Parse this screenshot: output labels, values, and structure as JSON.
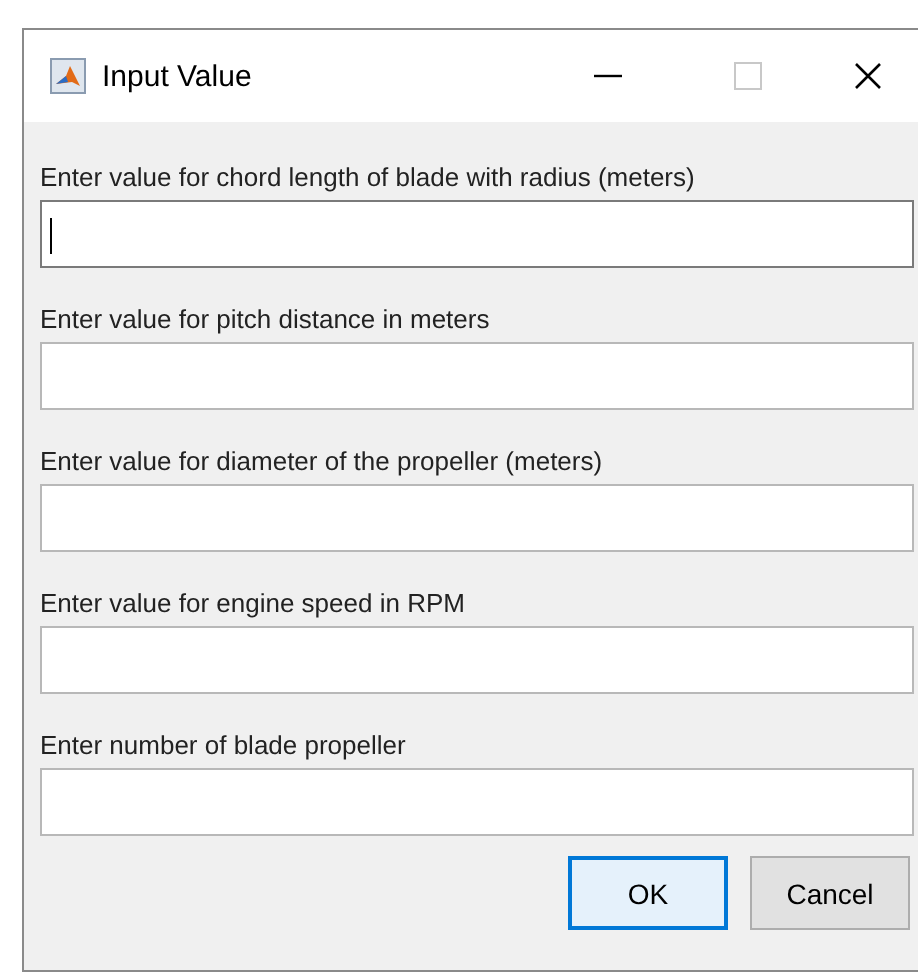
{
  "window": {
    "title": "Input Value"
  },
  "fields": [
    {
      "label": "Enter value for chord length of blade with radius (meters)",
      "focused": true
    },
    {
      "label": "Enter value for pitch distance in meters",
      "focused": false
    },
    {
      "label": "Enter value for diameter of the propeller (meters)",
      "focused": false
    },
    {
      "label": "Enter value for engine speed in RPM",
      "focused": false
    },
    {
      "label": "Enter number of blade propeller",
      "focused": false
    }
  ],
  "buttons": [
    {
      "label": "OK",
      "default": true
    },
    {
      "label": "Cancel",
      "default": false
    }
  ]
}
